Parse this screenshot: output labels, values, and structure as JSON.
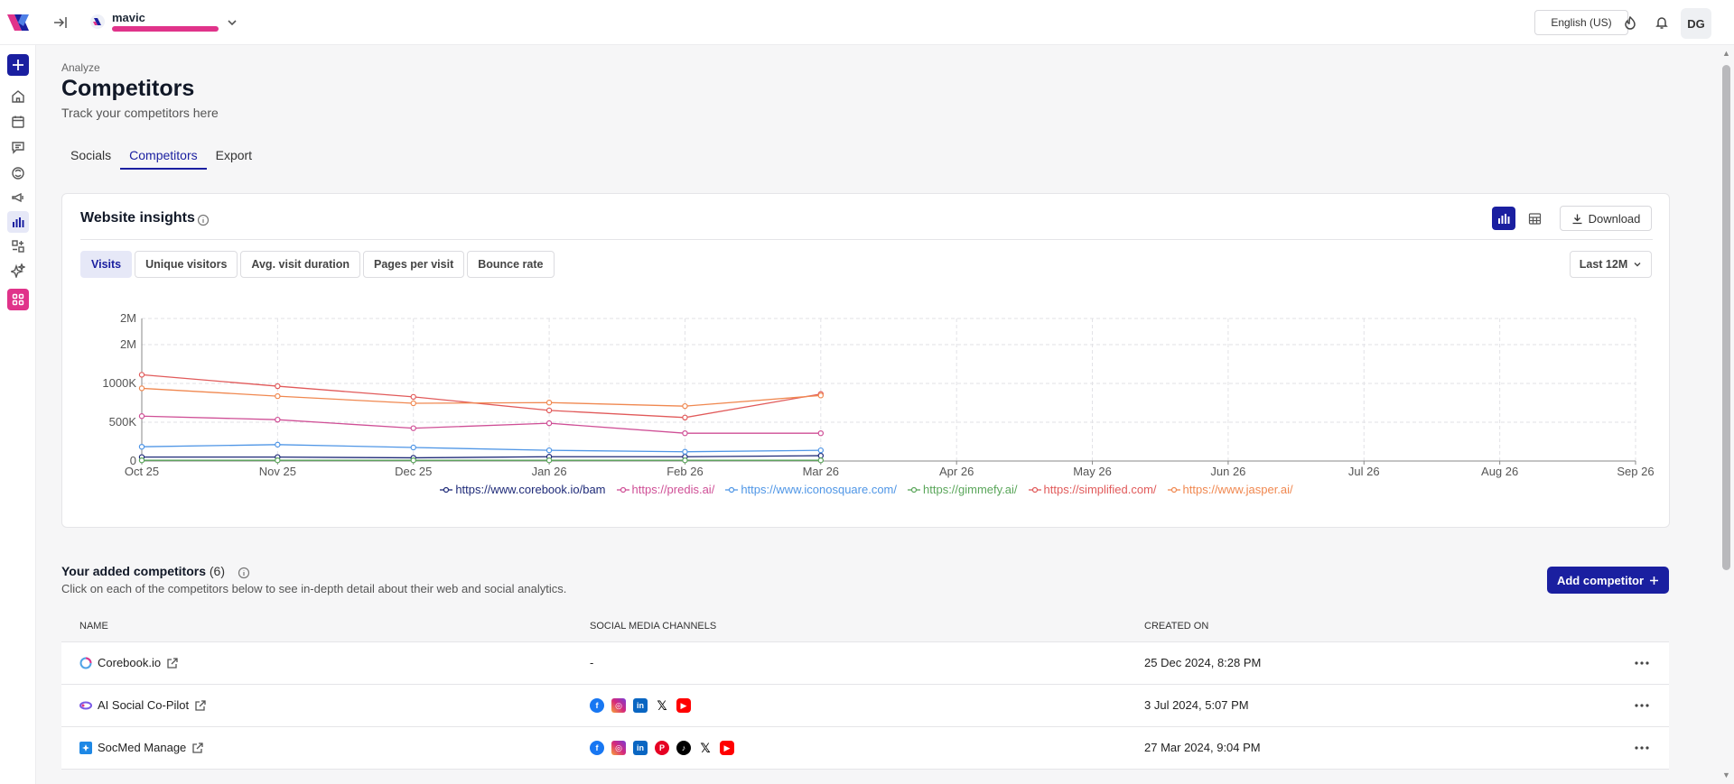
{
  "workspace": {
    "name": "mavic"
  },
  "topbar": {
    "language": "English (US)",
    "user_initials": "DG"
  },
  "page": {
    "breadcrumb": "Analyze",
    "title": "Competitors",
    "subtitle": "Track your competitors here"
  },
  "tabs": [
    {
      "label": "Socials",
      "active": false
    },
    {
      "label": "Competitors",
      "active": true
    },
    {
      "label": "Export",
      "active": false
    }
  ],
  "insights": {
    "title": "Website insights",
    "download_label": "Download",
    "metrics": [
      {
        "label": "Visits",
        "active": true
      },
      {
        "label": "Unique visitors",
        "active": false
      },
      {
        "label": "Avg. visit duration",
        "active": false
      },
      {
        "label": "Pages per visit",
        "active": false
      },
      {
        "label": "Bounce rate",
        "active": false
      }
    ],
    "range_label": "Last 12M"
  },
  "chart_data": {
    "type": "line",
    "x": [
      "Oct 25",
      "Nov 25",
      "Dec 25",
      "Jan 26",
      "Feb 26",
      "Mar 26",
      "Apr 26",
      "May 26",
      "Jun 26",
      "Jul 26",
      "Aug 26",
      "Sep 26"
    ],
    "y_ticks": [
      "0",
      "500K",
      "1000K",
      "2M",
      "2M"
    ],
    "ylim": [
      0,
      2000000
    ],
    "grid": true,
    "legend_position": "bottom",
    "series": [
      {
        "name": "https://www.corebook.io/bam",
        "color": "#1e2a78",
        "values": [
          55000,
          55000,
          45000,
          60000,
          60000,
          75000
        ]
      },
      {
        "name": "https://predis.ai/",
        "color": "#cf4f96",
        "values": [
          630000,
          580000,
          460000,
          530000,
          390000,
          390000
        ]
      },
      {
        "name": "https://www.iconosquare.com/",
        "color": "#4f96e6",
        "values": [
          200000,
          230000,
          190000,
          150000,
          130000,
          150000
        ]
      },
      {
        "name": "https://gimmefy.ai/",
        "color": "#5aa65a",
        "values": [
          10000,
          10000,
          10000,
          10000,
          10000,
          10000
        ]
      },
      {
        "name": "https://simplified.com/",
        "color": "#e15a5a",
        "values": [
          1210000,
          1050000,
          900000,
          710000,
          610000,
          940000
        ]
      },
      {
        "name": "https://www.jasper.ai/",
        "color": "#f08850",
        "values": [
          1020000,
          910000,
          810000,
          820000,
          770000,
          920000
        ]
      }
    ]
  },
  "competitors": {
    "title": "Your added competitors",
    "count": "(6)",
    "subtitle": "Click on each of the competitors below to see in-depth detail about their web and social analytics.",
    "add_label": "Add competitor",
    "columns": {
      "name": "Name",
      "channels": "Social media channels",
      "created": "Created on"
    },
    "rows": [
      {
        "name": "Corebook.io",
        "channels_text": "-",
        "channels": [],
        "created": "25 Dec 2024, 8:28 PM"
      },
      {
        "name": "AI Social Co-Pilot",
        "channels_text": "",
        "channels": [
          "facebook",
          "instagram",
          "linkedin",
          "x",
          "youtube"
        ],
        "created": "3 Jul 2024, 5:07 PM"
      },
      {
        "name": "SocMed Manage",
        "channels_text": "",
        "channels": [
          "facebook",
          "instagram",
          "linkedin",
          "pinterest",
          "tiktok",
          "x",
          "youtube"
        ],
        "created": "27 Mar 2024, 9:04 PM"
      }
    ]
  }
}
